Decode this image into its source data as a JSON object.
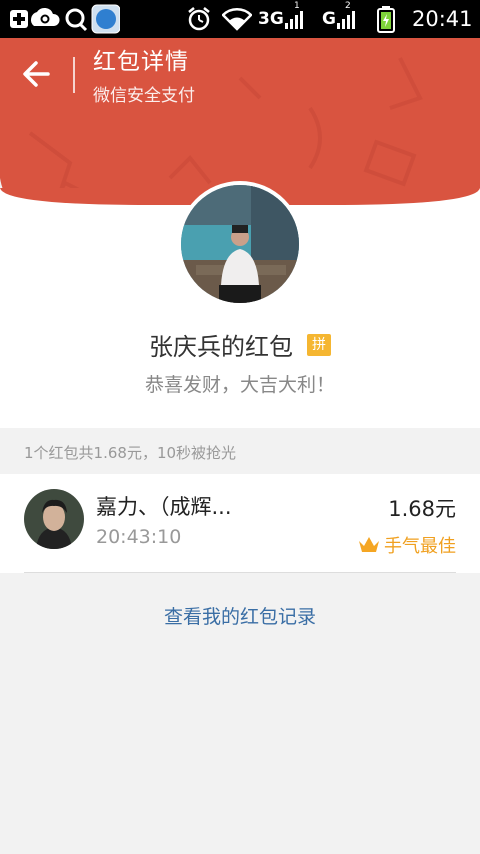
{
  "status_bar": {
    "time": "20:41",
    "network_1": "3G",
    "network_2": "G",
    "sim1_tag": "1",
    "sim2_tag": "2"
  },
  "header": {
    "title": "红包详情",
    "subtitle": "微信安全支付",
    "color": "#d95440"
  },
  "sender": {
    "name": "张庆兵的红包",
    "badge": "拼",
    "greeting": "恭喜发财，大吉大利！"
  },
  "summary": "1个红包共1.68元，10秒被抢光",
  "records": [
    {
      "name": "嘉力、（成辉...",
      "time": "20:43:10",
      "amount": "1.68元",
      "tag": "手气最佳"
    }
  ],
  "history_link": "查看我的红包记录",
  "icons": {
    "back": "arrow-left-icon",
    "crown": "crown-icon",
    "wifi": "wifi-icon",
    "alarm": "alarm-icon",
    "battery": "battery-icon"
  }
}
